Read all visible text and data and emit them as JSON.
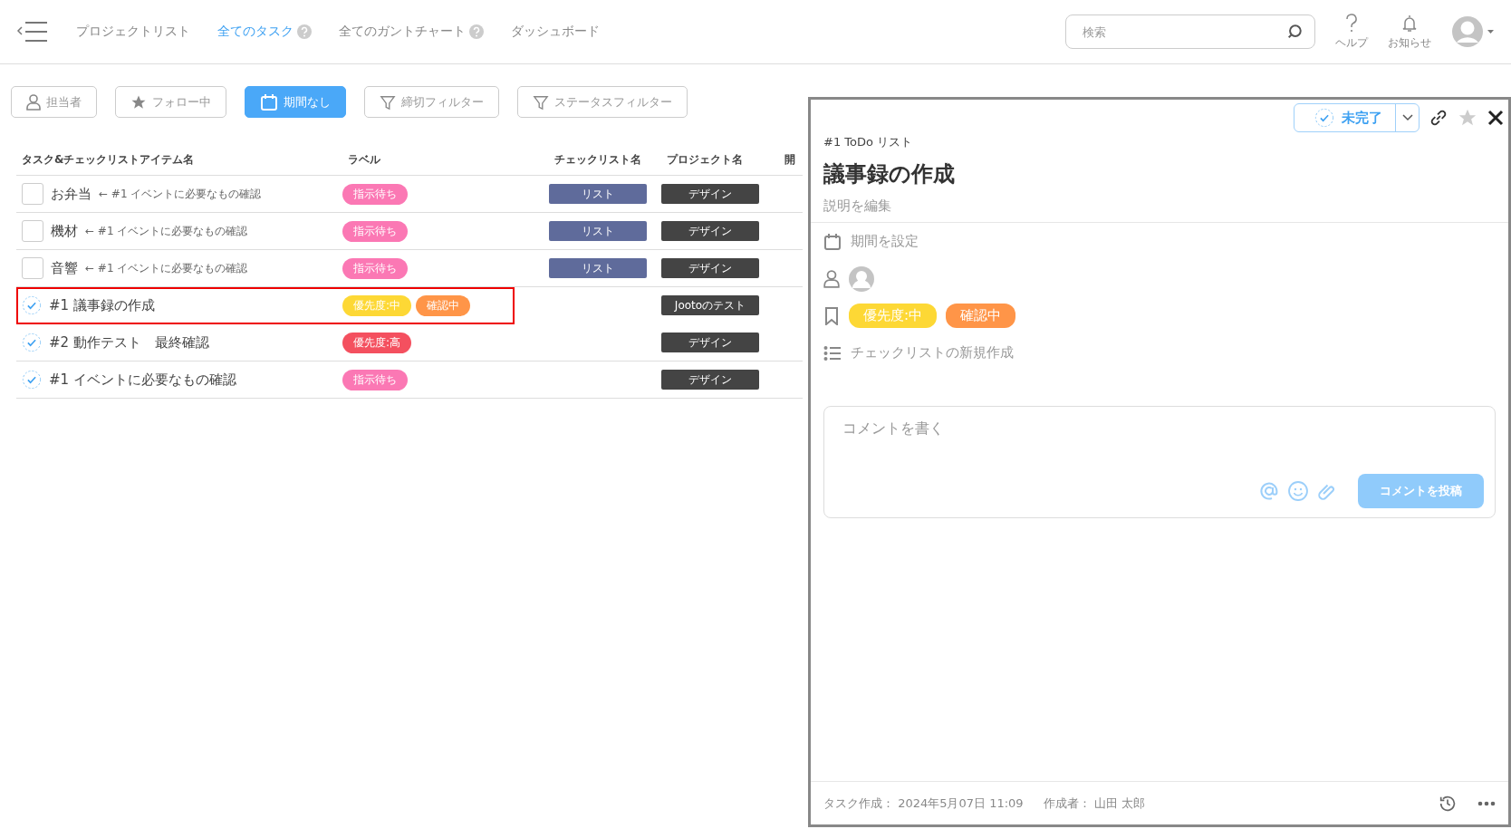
{
  "nav": {
    "items": [
      {
        "label": "プロジェクトリスト",
        "selected": false,
        "help": false
      },
      {
        "label": "全てのタスク",
        "selected": true,
        "help": true
      },
      {
        "label": "全てのガントチャート",
        "selected": false,
        "help": true
      },
      {
        "label": "ダッシュボード",
        "selected": false,
        "help": false
      }
    ],
    "search": {
      "placeholder": "検索"
    },
    "help_label": "ヘルプ",
    "notice_label": "お知らせ"
  },
  "filters": [
    {
      "kind": "person",
      "label": "担当者",
      "selected": false
    },
    {
      "kind": "star",
      "label": "フォロー中",
      "selected": false
    },
    {
      "kind": "calendar",
      "label": "期間なし",
      "selected": true
    },
    {
      "kind": "funnel",
      "label": "締切フィルター",
      "selected": false
    },
    {
      "kind": "funnel",
      "label": "ステータスフィルター",
      "selected": false
    }
  ],
  "table": {
    "columns": [
      "タスク&チェックリストアイテム名",
      "ラベル",
      "チェックリスト名",
      "プロジェクト名",
      "開"
    ],
    "rows": [
      {
        "kind": "checklist_item",
        "checked": false,
        "name": "お弁当",
        "parent": "← #1 イベントに必要なもの確認",
        "highlighted": false,
        "labels": [
          {
            "text": "指示待ち",
            "color": "#fb78b4"
          }
        ],
        "checklist": "リスト",
        "project": "デザイン"
      },
      {
        "kind": "checklist_item",
        "checked": false,
        "name": "機材",
        "parent": "← #1 イベントに必要なもの確認",
        "highlighted": false,
        "labels": [
          {
            "text": "指示待ち",
            "color": "#fb78b4"
          }
        ],
        "checklist": "リスト",
        "project": "デザイン"
      },
      {
        "kind": "checklist_item",
        "checked": false,
        "name": "音響",
        "parent": "← #1 イベントに必要なもの確認",
        "highlighted": false,
        "labels": [
          {
            "text": "指示待ち",
            "color": "#fb78b4"
          }
        ],
        "checklist": "リスト",
        "project": "デザイン"
      },
      {
        "kind": "task",
        "name": "#1 議事録の作成",
        "highlighted": true,
        "labels": [
          {
            "text": "優先度:中",
            "color": "#fdd835"
          },
          {
            "text": "確認中",
            "color": "#ff9548"
          }
        ],
        "project": "Jootoのテスト"
      },
      {
        "kind": "task",
        "name": "#2 動作テスト　最終確認",
        "highlighted": false,
        "labels": [
          {
            "text": "優先度:高",
            "color": "#f4505f"
          }
        ],
        "project": "デザイン"
      },
      {
        "kind": "task",
        "name": "#1 イベントに必要なもの確認",
        "highlighted": false,
        "labels": [
          {
            "text": "指示待ち",
            "color": "#fb78b4"
          }
        ],
        "project": "デザイン"
      }
    ]
  },
  "detail": {
    "status": "未完了",
    "list": "#1 ToDo リスト",
    "title": "議事録の作成",
    "description": "説明を編集",
    "due": "期間を設定",
    "labels": [
      {
        "text": "優先度:中",
        "color": "#fdd835"
      },
      {
        "text": "確認中",
        "color": "#ff9548"
      }
    ],
    "checklist_action": "チェックリストの新規作成",
    "comment": {
      "placeholder": "コメントを書く",
      "submit": "コメントを投稿"
    },
    "created": "タスク作成： 2024年5月07日 11:09",
    "author": "作成者： 山田 太郎"
  }
}
